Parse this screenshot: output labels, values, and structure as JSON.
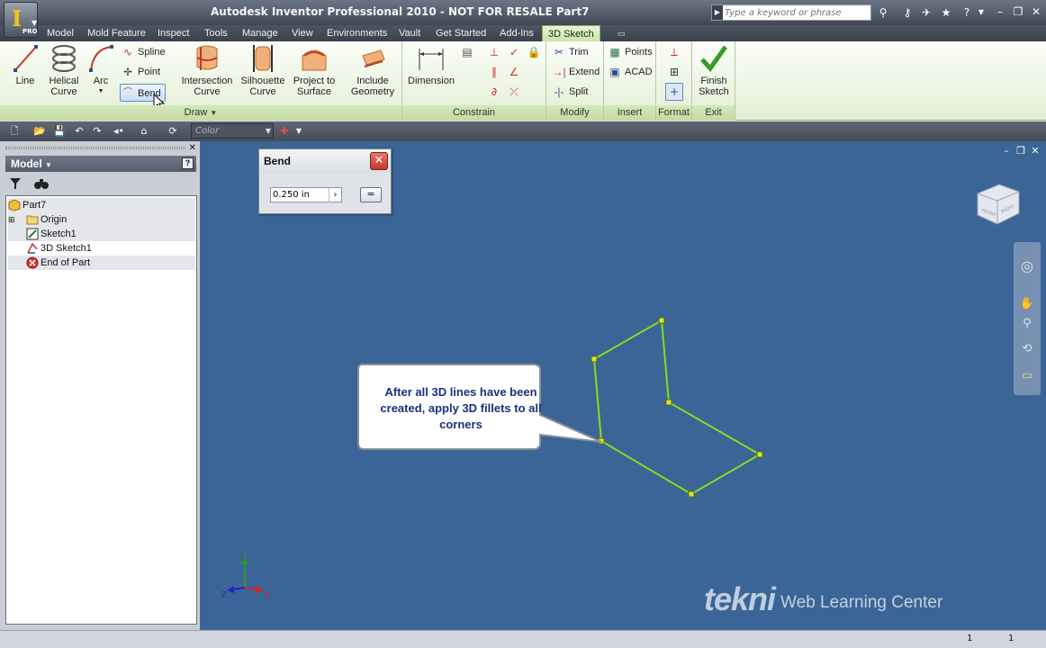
{
  "window": {
    "title": "Autodesk Inventor Professional 2010 - NOT FOR RESALE   Part7",
    "app_logo_text": "I",
    "app_edition": "PRO"
  },
  "search": {
    "placeholder": "Type a keyword or phrase"
  },
  "menu_tabs": [
    "Model",
    "Mold Feature",
    "Inspect",
    "Tools",
    "Manage",
    "View",
    "Environments",
    "Vault",
    "Get Started",
    "Add-Ins",
    "3D Sketch"
  ],
  "active_tab": "3D Sketch",
  "ribbon": {
    "draw": {
      "title": "Draw",
      "line": "Line",
      "helical_curve": "Helical Curve",
      "arc": "Arc",
      "spline": "Spline",
      "point": "Point",
      "bend": "Bend",
      "intersection_curve": "Intersection Curve",
      "silhouette_curve": "Silhouette Curve",
      "project_to_surface": "Project to Surface",
      "include_geometry": "Include Geometry"
    },
    "constrain": {
      "title": "Constrain",
      "dimension": "Dimension"
    },
    "modify": {
      "title": "Modify",
      "trim": "Trim",
      "extend": "Extend",
      "split": "Split"
    },
    "insert": {
      "title": "Insert",
      "points": "Points",
      "acad": "ACAD"
    },
    "format": {
      "title": "Format"
    },
    "exit": {
      "title": "Exit",
      "finish_sketch": "Finish Sketch"
    }
  },
  "qat": {
    "color_placeholder": "Color"
  },
  "browser": {
    "header": "Model",
    "tree": [
      {
        "label": "Part7",
        "icon": "part-icon"
      },
      {
        "label": "Origin",
        "icon": "folder-icon"
      },
      {
        "label": "Sketch1",
        "icon": "sketch-icon"
      },
      {
        "label": "3D Sketch1",
        "icon": "3d-sketch-icon"
      },
      {
        "label": "End of Part",
        "icon": "end-of-part-icon"
      }
    ]
  },
  "bend_dialog": {
    "title": "Bend",
    "radius_value": "0.250 in",
    "equal_label": "="
  },
  "callout": {
    "text": "After all 3D lines have been created, apply 3D fillets to all corners"
  },
  "triad": {
    "x": "X",
    "y": "Y",
    "z": "Z"
  },
  "watermark": {
    "brand": "tekni",
    "subtitle": "Web Learning Center"
  },
  "viewcube": {
    "front": "FRONT",
    "right": "RIGHT"
  },
  "status": {
    "count_left": "1",
    "count_right": "1"
  },
  "colors": {
    "viewport_bg": "#3b6596",
    "sketch_line": "#7ee020",
    "sketch_point": "#d9e62a",
    "callout_text": "#1c2f7a",
    "ribbon_bg": "#e3efd3"
  }
}
